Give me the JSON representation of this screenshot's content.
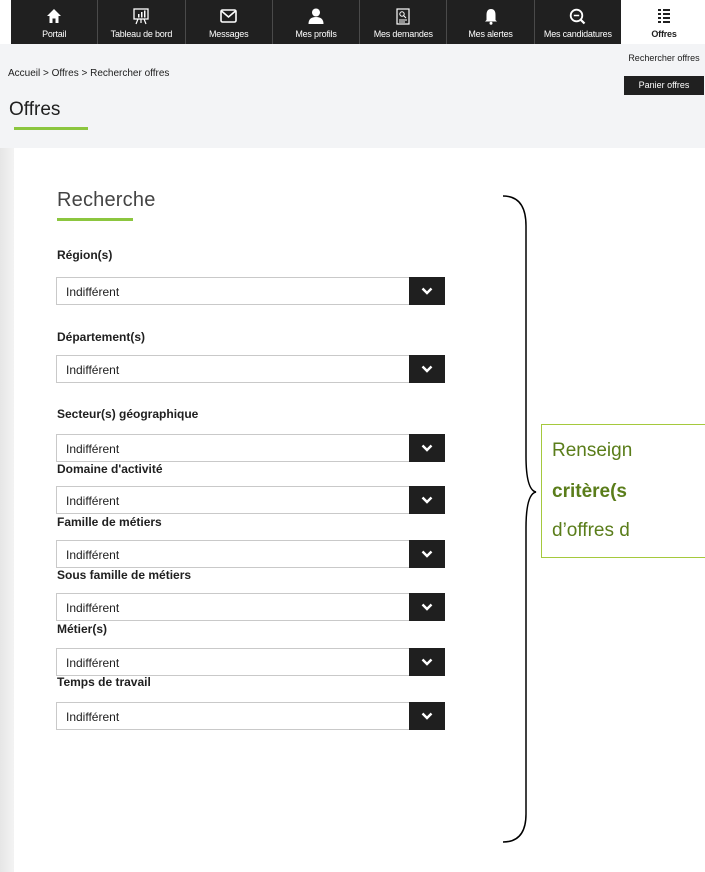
{
  "nav": {
    "items": [
      {
        "label": "Portail",
        "icon": "home-icon"
      },
      {
        "label": "Tableau de bord",
        "icon": "dashboard-icon"
      },
      {
        "label": "Messages",
        "icon": "envelope-icon"
      },
      {
        "label": "Mes profils",
        "icon": "user-icon"
      },
      {
        "label": "Mes demandes",
        "icon": "document-icon"
      },
      {
        "label": "Mes alertes",
        "icon": "bell-icon"
      },
      {
        "label": "Mes candidatures",
        "icon": "search-icon"
      }
    ],
    "active": {
      "label": "Offres",
      "icon": "list-icon"
    },
    "submenu": {
      "search_label": "Rechercher offres",
      "cart_label": "Panier offres"
    }
  },
  "breadcrumb": {
    "home": "Accueil",
    "sep1": " > ",
    "offres": "Offres",
    "sep2": " > ",
    "current": "Rechercher offres"
  },
  "page_title": "Offres",
  "search": {
    "title": "Recherche",
    "fields": [
      {
        "label": "Région(s)",
        "value": "Indifférent"
      },
      {
        "label": "Département(s)",
        "value": "Indifférent"
      },
      {
        "label": "Secteur(s) géographique",
        "value": "Indifférent"
      },
      {
        "label": "Domaine d'activité",
        "value": "Indifférent"
      },
      {
        "label": "Famille de métiers",
        "value": "Indifférent"
      },
      {
        "label": "Sous famille de métiers",
        "value": "Indifférent"
      },
      {
        "label": "Métier(s)",
        "value": "Indifférent"
      },
      {
        "label": "Temps de travail",
        "value": "Indifférent"
      }
    ]
  },
  "callout": {
    "line1": "Renseign",
    "line2": "critère(s",
    "line3": "d’offres d"
  },
  "colors": {
    "accent": "#8cc63f",
    "nav_bg": "#202020",
    "callout_text": "#5a7d1a",
    "callout_border": "#a5c93d"
  }
}
